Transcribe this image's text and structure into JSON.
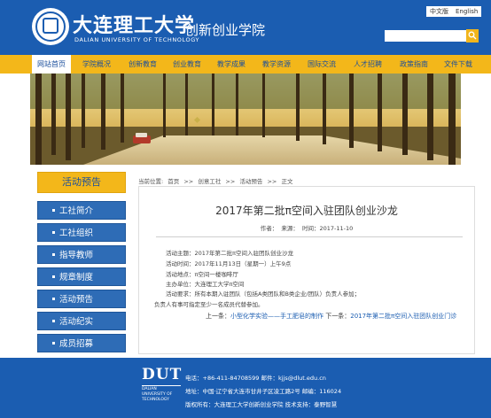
{
  "header": {
    "university_cn": "大连理工大学",
    "university_en": "DALIAN UNIVERSITY OF TECHNOLOGY",
    "college": "创新创业学院",
    "lang_zh": "中文版",
    "lang_en": "English",
    "search_placeholder": ""
  },
  "nav": {
    "items": [
      "网站首页",
      "学院概况",
      "创新教育",
      "创业教育",
      "教学成果",
      "教学资源",
      "国际交流",
      "人才招聘",
      "政策指南",
      "文件下载"
    ],
    "active": "网站首页"
  },
  "sidebar": {
    "heading": "活动预告",
    "items": [
      "工社简介",
      "工社组织",
      "指导教师",
      "规章制度",
      "活动预告",
      "活动纪实",
      "成员招募"
    ]
  },
  "breadcrumb": {
    "label": "当前位置:",
    "parts": [
      "首页",
      ">>",
      "创意工社",
      ">>",
      "活动预告",
      ">>",
      "正文"
    ]
  },
  "article": {
    "title": "2017年第二批π空间入驻团队创业沙龙",
    "meta": {
      "author": "作者：",
      "source": "来源：",
      "time": "时间：2017-11-10"
    },
    "lines": [
      "活动主题：2017年第二批π空间入驻团队创业沙龙",
      "活动时间：2017年11月13日（星期一）上午9点",
      "活动地点：π空间一楼咖啡厅",
      "主办单位：大连理工大学π空间",
      "活动要求：所有本期入驻团队（包括A类团队和B类企业/团队）负责人参加；",
      "负责人有事可指定至少一名成员代替参加。"
    ],
    "prev_label": "上一条：",
    "prev_link": "小型化学实验——手工肥皂的制作",
    "next_label": "下一条：",
    "next_link": "2017年第二批π空间入驻团队创业门诊"
  },
  "footer": {
    "logo_text": "DUT",
    "logo_sub": [
      "DALIAN",
      "UNIVERSITY OF",
      "TECHNOLOGY"
    ],
    "phone_line": "电话：+86-411-84708599 邮件：kjjs@dlut.edu.cn",
    "address_line": "地址：中国·辽宁省大连市甘井子区凌工路2号 邮编：116024",
    "copyright_line": "版权所有：大连理工大学创新创业学院 技术支持：泰野智慧"
  },
  "colors": {
    "primary_blue": "#1b5db1",
    "accent_yellow": "#f3b71a"
  }
}
